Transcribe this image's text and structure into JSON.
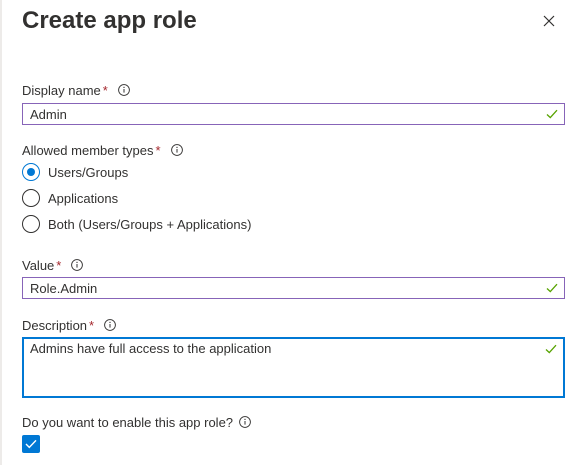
{
  "panel": {
    "title": "Create app role"
  },
  "display_name": {
    "label": "Display name",
    "required_mark": "*",
    "value": "Admin"
  },
  "member_types": {
    "label": "Allowed member types",
    "required_mark": "*",
    "options": [
      {
        "label": "Users/Groups",
        "selected": true
      },
      {
        "label": "Applications",
        "selected": false
      },
      {
        "label": "Both (Users/Groups + Applications)",
        "selected": false
      }
    ]
  },
  "value_field": {
    "label": "Value",
    "required_mark": "*",
    "value": "Role.Admin"
  },
  "description": {
    "label": "Description",
    "required_mark": "*",
    "value": "Admins have full access to the application"
  },
  "enable": {
    "label": "Do you want to enable this app role?",
    "checked": true
  },
  "colors": {
    "accent": "#0078d4",
    "valid_border": "#8764b8",
    "valid_check": "#57a300",
    "required": "#a4262c"
  },
  "icons": {
    "close": "close-icon",
    "info": "info-icon",
    "valid": "checkmark-icon"
  }
}
